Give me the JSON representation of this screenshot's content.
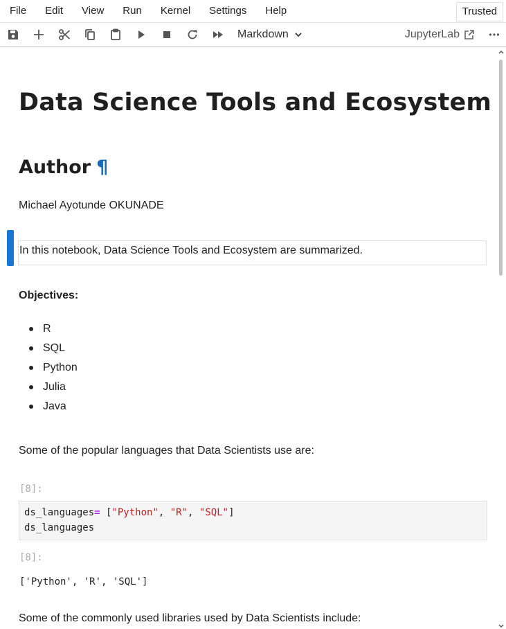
{
  "menu": [
    "File",
    "Edit",
    "View",
    "Run",
    "Kernel",
    "Settings",
    "Help"
  ],
  "trusted_label": "Trusted",
  "toolbar": {
    "icons": [
      "save-icon",
      "add-cell-icon",
      "cut-icon",
      "copy-icon",
      "paste-icon",
      "run-icon",
      "stop-icon",
      "restart-icon",
      "run-all-icon"
    ],
    "cell_type": "Markdown",
    "jupyterlab_label": "JupyterLab"
  },
  "notebook": {
    "title": "Data Science Tools and Ecosystem",
    "author_heading": "Author",
    "author_anchor": "¶",
    "author_name": "Michael Ayotunde OKUNADE",
    "intro": "In this notebook, Data Science Tools and Ecosystem are summarized.",
    "objectives_label": "Objectives:",
    "objectives": [
      "R",
      "SQL",
      "Python",
      "Julia",
      "Java"
    ],
    "languages_intro": "Some of the popular languages that Data Scientists use are:",
    "input_prompt": "[8]:",
    "code": {
      "line1_var": "ds_languages",
      "line1_op": "=",
      "line1_open": " [",
      "str1": "\"Python\"",
      "comma1": ", ",
      "str2": "\"R\"",
      "comma2": ", ",
      "str3": "\"SQL\"",
      "line1_close": "]",
      "line2": "ds_languages"
    },
    "output_prompt": "[8]:",
    "output_text": "['Python', 'R', 'SQL']",
    "libraries_intro": "Some of the commonly used libraries used by Data Scientists include:"
  },
  "colors": {
    "accent": "#1976d2",
    "anchor": "#1a6ab7",
    "keyword": "#aa22ff",
    "string": "#ba2121"
  }
}
